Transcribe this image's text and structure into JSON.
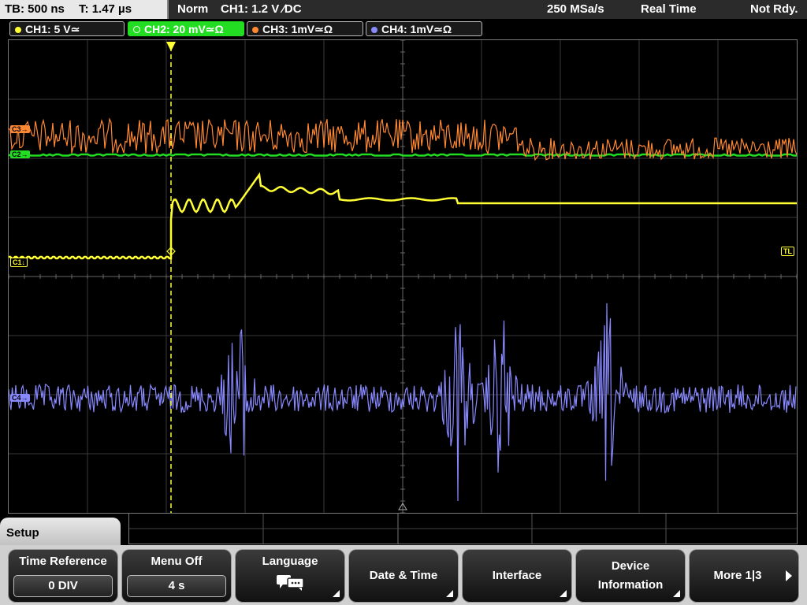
{
  "status": {
    "timebase": "TB: 500 ns",
    "trigger_time": "T: 1.47 µs",
    "mode": "Norm",
    "trigger": "CH1: 1.2 V ∕DC",
    "sample_rate": "250 MSa/s",
    "acq_mode": "Real Time",
    "state": "Not Rdy."
  },
  "channels": [
    {
      "label": "CH1: 5 V≃",
      "color": "#ffff33"
    },
    {
      "label": "CH2: 20 mV≃Ω",
      "color": "#22dd22",
      "active": true
    },
    {
      "label": "CH3: 1mV≃Ω",
      "color": "#ff8833"
    },
    {
      "label": "CH4: 1mV≃Ω",
      "color": "#8888ff"
    }
  ],
  "markers": {
    "c1": "C1↓",
    "tl": "TL",
    "c2": "C2→",
    "c3": "C3→",
    "c4": "C4→"
  },
  "menu": {
    "tab": "Setup",
    "keys": [
      {
        "title": "Time Reference",
        "value": "0 DIV"
      },
      {
        "title": "Menu Off",
        "value": "4 s"
      },
      {
        "title": "Language",
        "icon": "speech-bubble-icon"
      },
      {
        "title": "Date & Time"
      },
      {
        "title": "Interface"
      },
      {
        "title": "Device Information"
      },
      {
        "title": "More 1|3"
      }
    ]
  },
  "colors": {
    "ch1": "#ffff33",
    "ch2": "#22dd22",
    "ch3": "#ff8833",
    "ch4": "#8888ff"
  }
}
